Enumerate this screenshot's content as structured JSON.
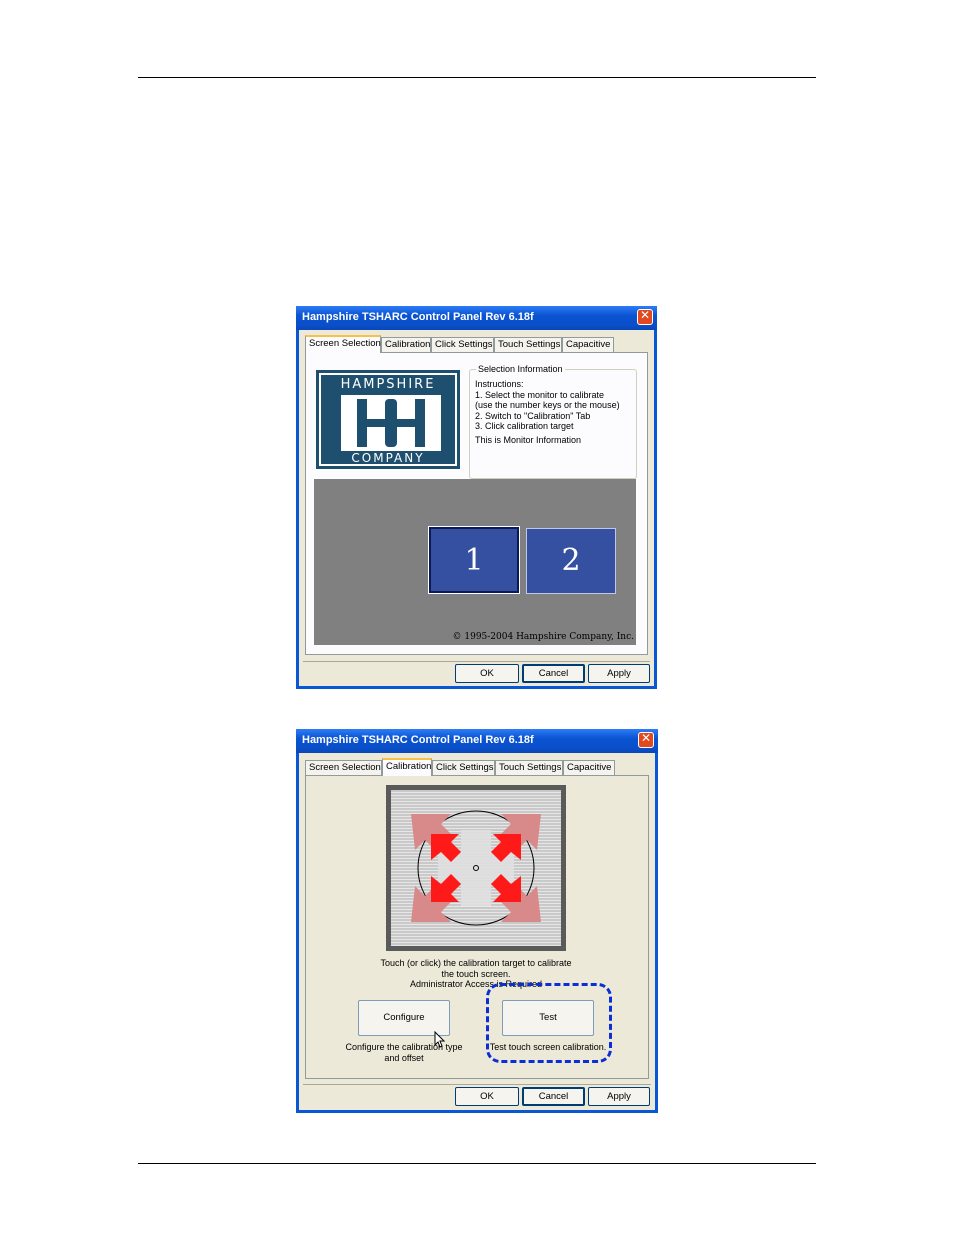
{
  "window1": {
    "title": "Hampshire TSHARC Control Panel Rev 6.18f",
    "tabs": [
      "Screen Selection",
      "Calibration",
      "Click Settings",
      "Touch Settings",
      "Capacitive"
    ],
    "logo_top": "HAMPSHIRE",
    "logo_bottom": "COMPANY",
    "selection_info": {
      "legend": "Selection Information",
      "lines": [
        "Instructions:",
        "1. Select the monitor to calibrate",
        "(use the number keys or the mouse)",
        "2. Switch to \"Calibration\" Tab",
        "3. Click calibration target",
        "This is Monitor Information"
      ]
    },
    "monitors": [
      "1",
      "2"
    ],
    "copyright": "© 1995-2004 Hampshire Company, Inc.",
    "buttons": {
      "ok": "OK",
      "cancel": "Cancel",
      "apply": "Apply"
    }
  },
  "window2": {
    "title": "Hampshire TSHARC Control Panel Rev 6.18f",
    "tabs": [
      "Screen Selection",
      "Calibration",
      "Click Settings",
      "Touch Settings",
      "Capacitive"
    ],
    "calib_text": [
      "Touch (or click) the calibration target to calibrate",
      "the touch screen.",
      "Administrator Access is Required"
    ],
    "configure_label": "Configure",
    "configure_desc": [
      "Configure the calibration type",
      "and offset"
    ],
    "test_label": "Test",
    "test_desc": "Test touch screen calibration.",
    "buttons": {
      "ok": "OK",
      "cancel": "Cancel",
      "apply": "Apply"
    }
  },
  "colors": {
    "arrow_red": "#ff1a1a",
    "arrow_pink": "#d98c8c",
    "highlight_dash": "#0a2fd6",
    "titlebar": "#0a53d1"
  }
}
